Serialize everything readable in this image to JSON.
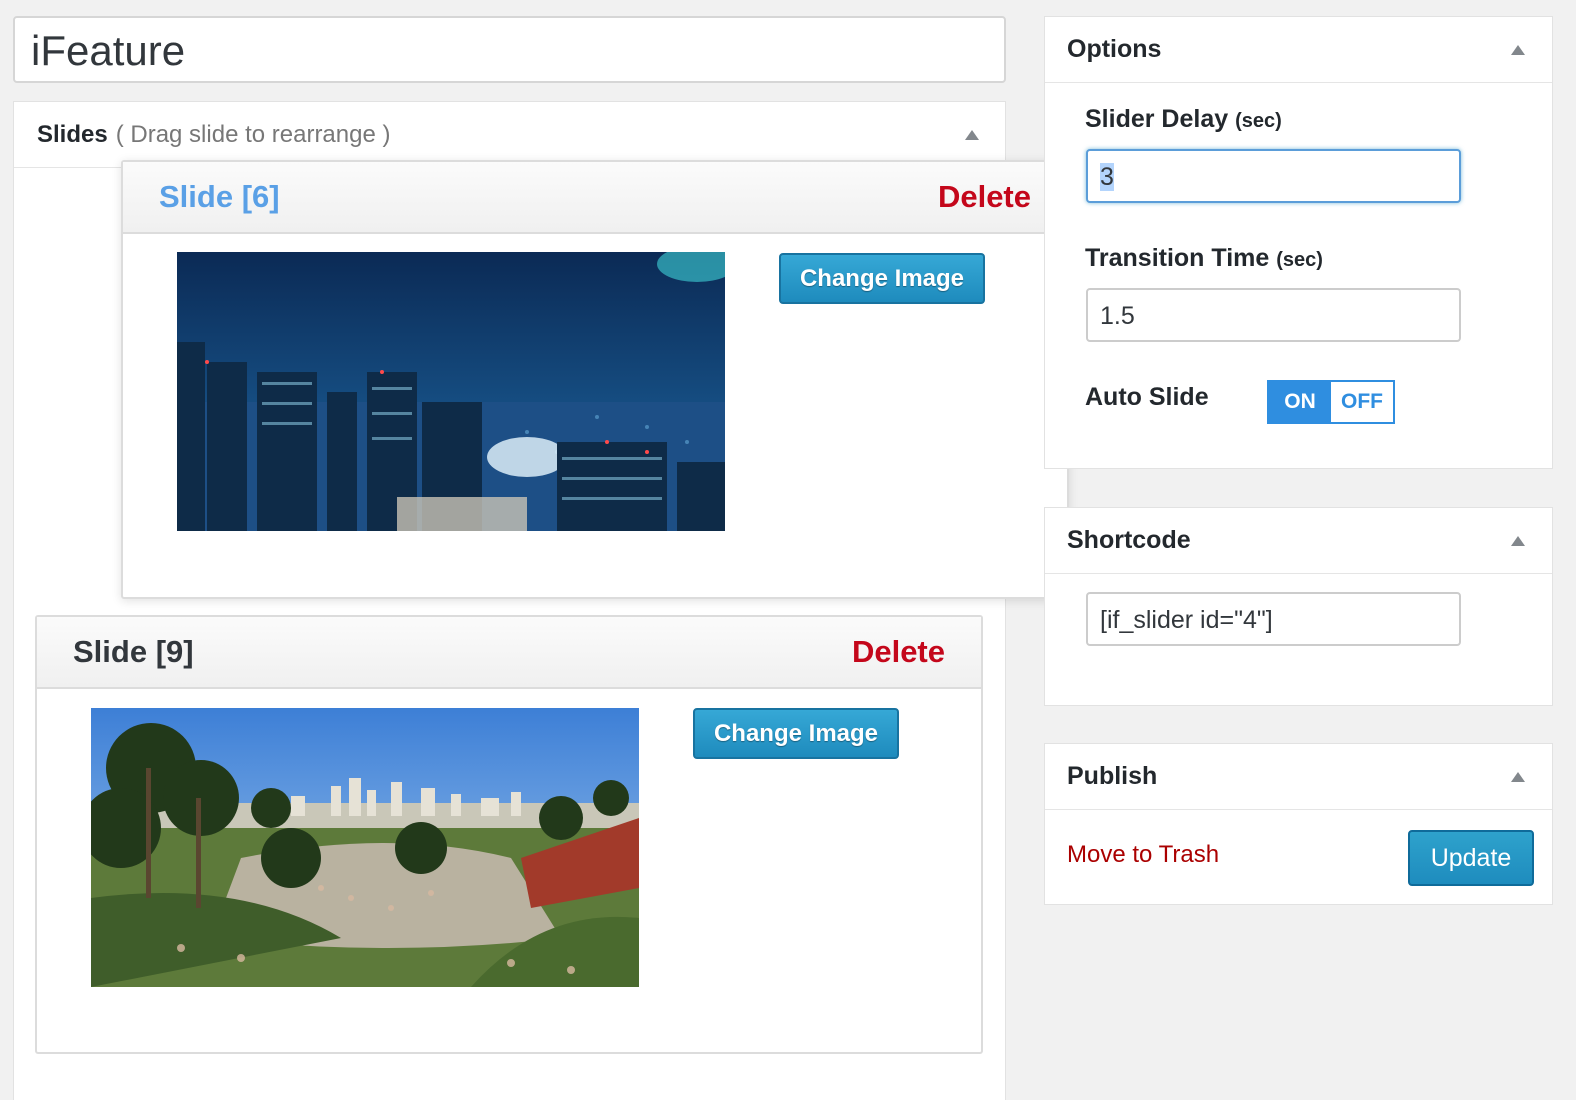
{
  "post": {
    "title": "iFeature"
  },
  "slides_panel": {
    "title": "Slides",
    "hint": "( Drag slide to rearrange )"
  },
  "slides": [
    {
      "title": "Slide [6]",
      "delete_label": "Delete",
      "change_label": "Change Image",
      "image": "city-night-skyline"
    },
    {
      "title": "Slide [9]",
      "delete_label": "Delete",
      "change_label": "Change Image",
      "image": "park-with-palm-trees"
    }
  ],
  "options": {
    "title": "Options",
    "slider_delay_label": "Slider Delay",
    "slider_delay_unit": "(sec)",
    "slider_delay_value": "3",
    "transition_label": "Transition Time",
    "transition_unit": "(sec)",
    "transition_value": "1.5",
    "auto_slide_label": "Auto Slide",
    "toggle_on": "ON",
    "toggle_off": "OFF"
  },
  "shortcode": {
    "title": "Shortcode",
    "value": "[if_slider id=\"4\"]"
  },
  "publish": {
    "title": "Publish",
    "trash_label": "Move to Trash",
    "update_label": "Update"
  },
  "colors": {
    "accent": "#2ea2cc",
    "delete": "#c4071b",
    "dragging_title": "#5aa0e6",
    "toggle": "#2f8ee0"
  }
}
